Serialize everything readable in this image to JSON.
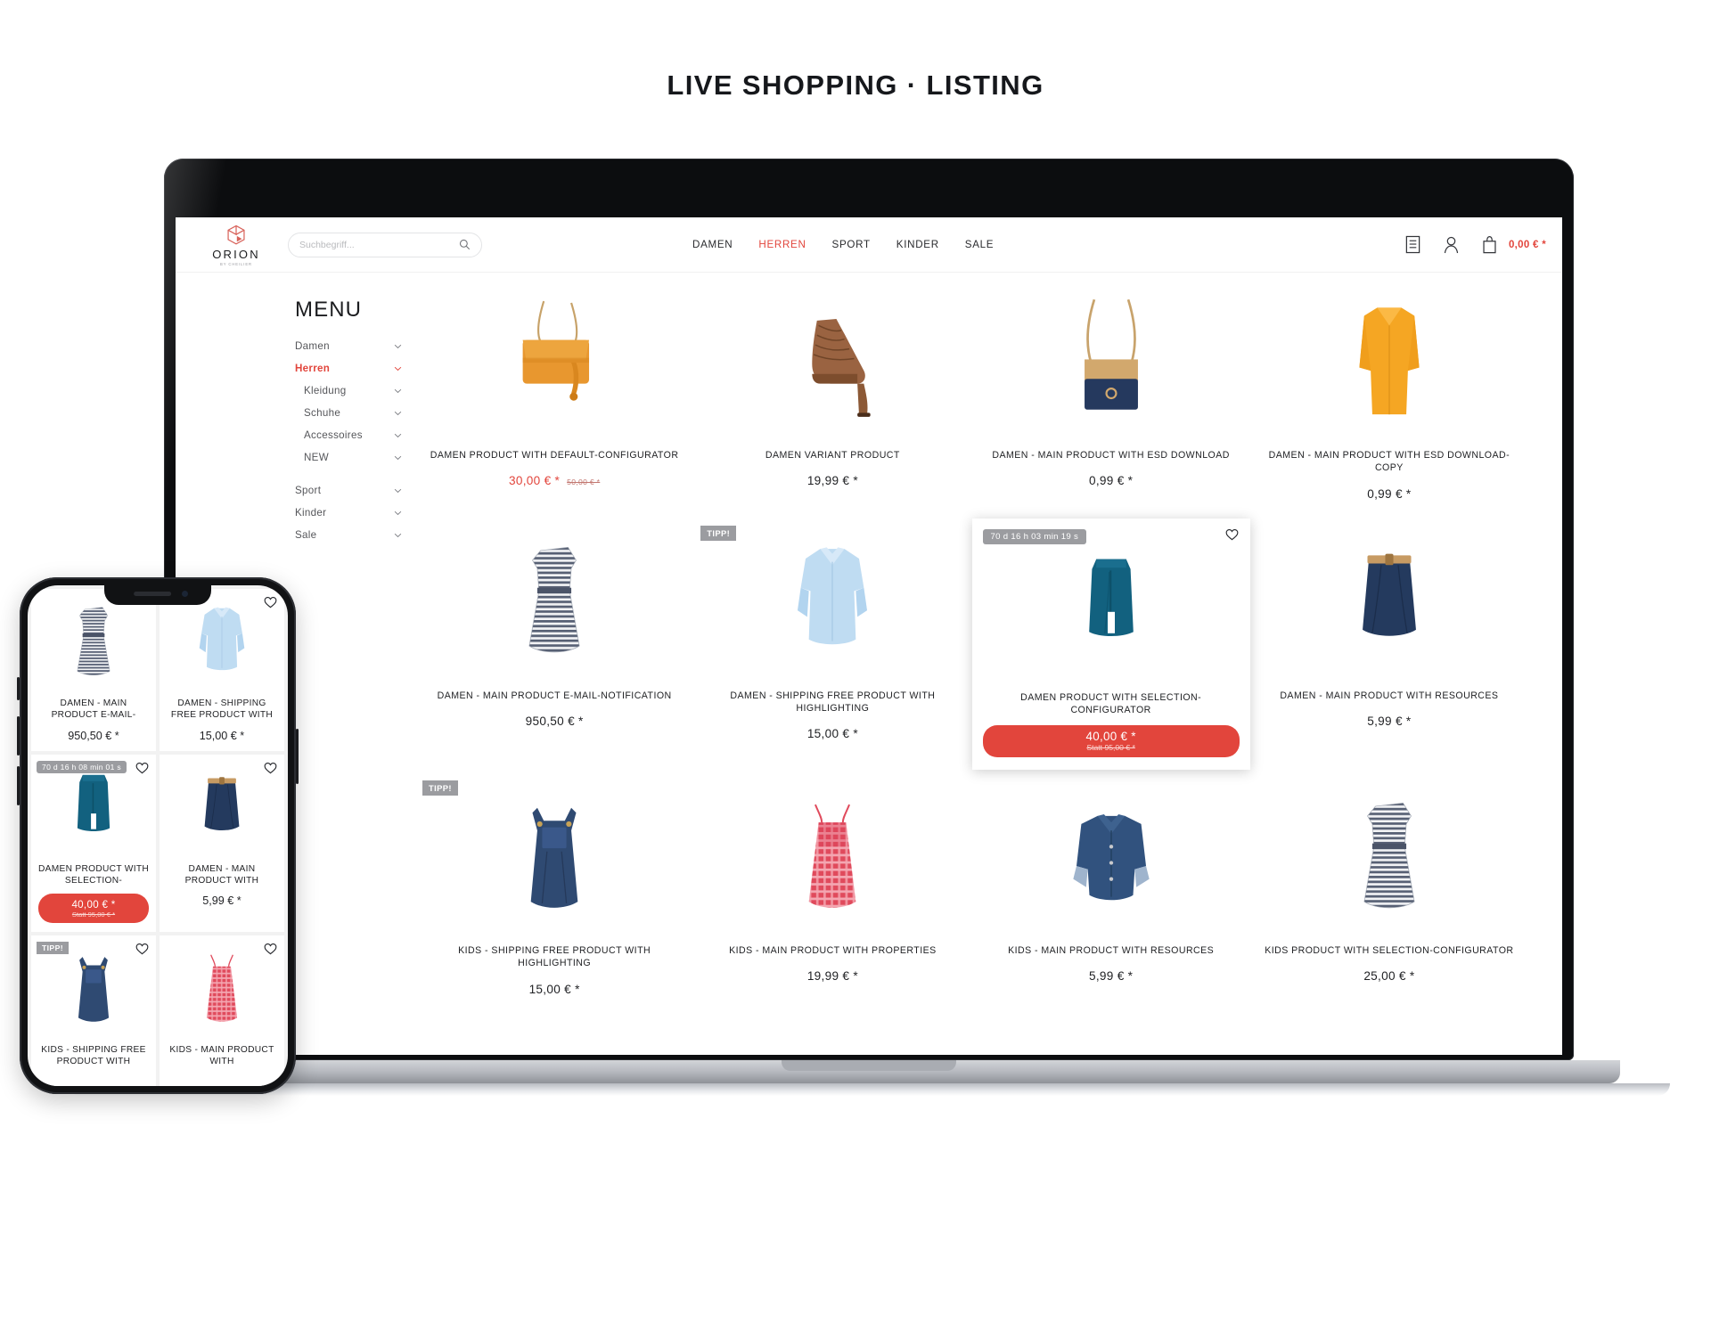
{
  "page": {
    "title": "LIVE SHOPPING · LISTING"
  },
  "shop": {
    "logo": {
      "word": "ORION",
      "sub": "BY CHEILIER",
      "icon": "cube-icon"
    },
    "search": {
      "value": "",
      "placeholder": "Suchbegriff...",
      "icon": "search-icon"
    },
    "nav": [
      {
        "label": "DAMEN",
        "active": false
      },
      {
        "label": "HERREN",
        "active": true
      },
      {
        "label": "SPORT",
        "active": false
      },
      {
        "label": "KINDER",
        "active": false
      },
      {
        "label": "SALE",
        "active": false
      }
    ],
    "actions": {
      "notes_icon": "notepad-icon",
      "account_icon": "user-icon",
      "cart_icon": "shopping-bag-icon",
      "cart_total": "0,00 € *"
    },
    "accent_color": "#e2453c",
    "badge_color": "#9b9ca0"
  },
  "sidebar": {
    "heading": "MENU",
    "items": [
      {
        "label": "Damen",
        "level": 0,
        "active": false
      },
      {
        "label": "Herren",
        "level": 0,
        "active": true
      },
      {
        "label": "Kleidung",
        "level": 1,
        "active": false
      },
      {
        "label": "Schuhe",
        "level": 1,
        "active": false
      },
      {
        "label": "Accessoires",
        "level": 1,
        "active": false
      },
      {
        "label": "NEW",
        "level": 1,
        "active": false
      },
      {
        "label": "Sport",
        "level": 0,
        "active": false
      },
      {
        "label": "Kinder",
        "level": 0,
        "active": false
      },
      {
        "label": "Sale",
        "level": 0,
        "active": false
      }
    ],
    "chevron_icon": "chevron-down-icon"
  },
  "products": [
    {
      "title": "DAMEN PRODUCT WITH DEFAULT-CONFIGURATOR",
      "price": "30,00 € *",
      "old_price": "50,00 € *",
      "sale": true,
      "image": "orange-shoulder-bag",
      "badge": null,
      "wishlist": false,
      "highlight": false
    },
    {
      "title": "DAMEN VARIANT PRODUCT",
      "price": "19,99 € *",
      "old_price": null,
      "sale": false,
      "image": "brown-ankle-boot",
      "badge": null,
      "wishlist": false,
      "highlight": false
    },
    {
      "title": "DAMEN - MAIN PRODUCT WITH ESD DOWNLOAD",
      "price": "0,99 € *",
      "old_price": null,
      "sale": false,
      "image": "navy-tan-tote-bag",
      "badge": null,
      "wishlist": false,
      "highlight": false
    },
    {
      "title": "DAMEN - MAIN PRODUCT WITH ESD DOWNLOAD-COPY",
      "price": "0,99 € *",
      "old_price": null,
      "sale": false,
      "image": "orange-cardigan",
      "badge": null,
      "wishlist": false,
      "highlight": false
    },
    {
      "title": "DAMEN - MAIN PRODUCT E-MAIL-NOTIFICATION",
      "price": "950,50 € *",
      "old_price": null,
      "sale": false,
      "image": "striped-dress",
      "badge": null,
      "wishlist": false,
      "highlight": false
    },
    {
      "title": "DAMEN - SHIPPING FREE PRODUCT WITH HIGHLIGHTING",
      "price": "15,00 € *",
      "old_price": null,
      "sale": false,
      "image": "light-blue-blouse",
      "badge": "TIPP!",
      "badge_type": "tipp",
      "wishlist": false,
      "highlight": false
    },
    {
      "title": "DAMEN PRODUCT WITH SELECTION-CONFIGURATOR",
      "price": "40,00 € *",
      "old_price": "Statt 95,00 € *",
      "sale": true,
      "image": "teal-skirt",
      "badge": "70 d 16 h 03 min 19 s",
      "badge_type": "countdown",
      "wishlist": true,
      "highlight": true
    },
    {
      "title": "DAMEN - MAIN PRODUCT WITH RESOURCES",
      "price": "5,99 € *",
      "old_price": null,
      "sale": false,
      "image": "navy-skirt-belt",
      "badge": null,
      "wishlist": false,
      "highlight": false
    },
    {
      "title": "KIDS - SHIPPING FREE PRODUCT WITH HIGHLIGHTING",
      "price": "15,00 € *",
      "old_price": null,
      "sale": false,
      "image": "denim-dungaree-dress",
      "badge": "TIPP!",
      "badge_type": "tipp",
      "wishlist": false,
      "highlight": false
    },
    {
      "title": "KIDS - MAIN PRODUCT WITH PROPERTIES",
      "price": "19,99 € *",
      "old_price": null,
      "sale": false,
      "image": "red-check-dress",
      "badge": null,
      "wishlist": false,
      "highlight": false
    },
    {
      "title": "KIDS - MAIN PRODUCT WITH RESOURCES",
      "price": "5,99 € *",
      "old_price": null,
      "sale": false,
      "image": "denim-jacket",
      "badge": null,
      "wishlist": false,
      "highlight": false
    },
    {
      "title": "KIDS PRODUCT WITH SELECTION-CONFIGURATOR",
      "price": "25,00 € *",
      "old_price": null,
      "sale": false,
      "image": "striped-dress",
      "badge": null,
      "wishlist": false,
      "highlight": false
    }
  ],
  "phone": {
    "products": [
      {
        "title": "DAMEN - MAIN PRODUCT E-MAIL-",
        "price": "950,50 € *",
        "old_price": null,
        "image": "striped-dress",
        "badge": null,
        "wishlist": false,
        "highlight": false
      },
      {
        "title": "DAMEN - SHIPPING FREE PRODUCT WITH",
        "price": "15,00 € *",
        "old_price": null,
        "image": "light-blue-blouse",
        "badge": null,
        "wishlist": true,
        "highlight": false
      },
      {
        "title": "DAMEN PRODUCT WITH SELECTION-",
        "price": "40,00 € *",
        "old_price": "Statt 95,00 € *",
        "image": "teal-skirt",
        "badge": "70 d 16 h 08 min 01 s",
        "badge_type": "countdown",
        "wishlist": true,
        "highlight": true
      },
      {
        "title": "DAMEN - MAIN PRODUCT WITH",
        "price": "5,99 € *",
        "old_price": null,
        "image": "navy-skirt-belt",
        "badge": null,
        "wishlist": true,
        "highlight": false
      },
      {
        "title": "KIDS - SHIPPING FREE PRODUCT WITH",
        "price": "",
        "old_price": null,
        "image": "denim-dungaree-dress",
        "badge": "TIPP!",
        "badge_type": "tipp",
        "wishlist": true,
        "highlight": false
      },
      {
        "title": "KIDS - MAIN PRODUCT WITH",
        "price": "",
        "old_price": null,
        "image": "red-check-dress",
        "badge": null,
        "wishlist": true,
        "highlight": false
      }
    ]
  }
}
